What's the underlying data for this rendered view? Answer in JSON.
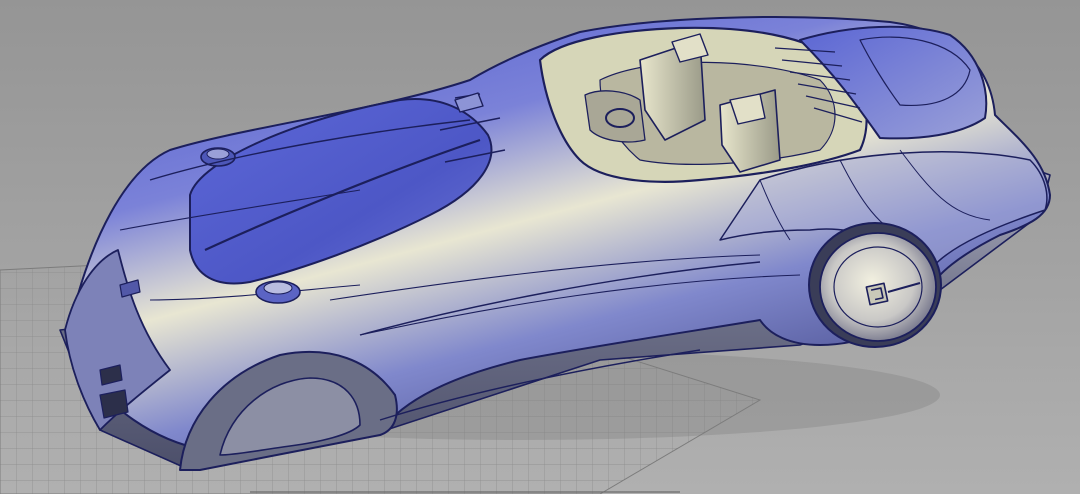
{
  "viewport": {
    "background_color": "#9c9c9c",
    "grid_color": "#8a8a8a",
    "grid_visible": true
  },
  "model": {
    "paint_color": "#4e5ad0",
    "highlight_color": "#f2f0d8",
    "shadow_color": "#5a5e6a",
    "surface_line_color": "#1c1f5c",
    "interior_color": "#d6d6b8",
    "components": [
      "body-shell",
      "front-hood",
      "hood-vents",
      "front-wheel-arch",
      "rear-wheel",
      "rear-wheel-hub",
      "cockpit",
      "seat-left",
      "seat-right",
      "headrest-left",
      "headrest-right",
      "dashboard",
      "steering-wheel",
      "rear-deck",
      "rear-deck-grille",
      "side-mirror",
      "fuel-cap-left",
      "fuel-cap-right",
      "front-bumper",
      "front-lamps"
    ]
  }
}
